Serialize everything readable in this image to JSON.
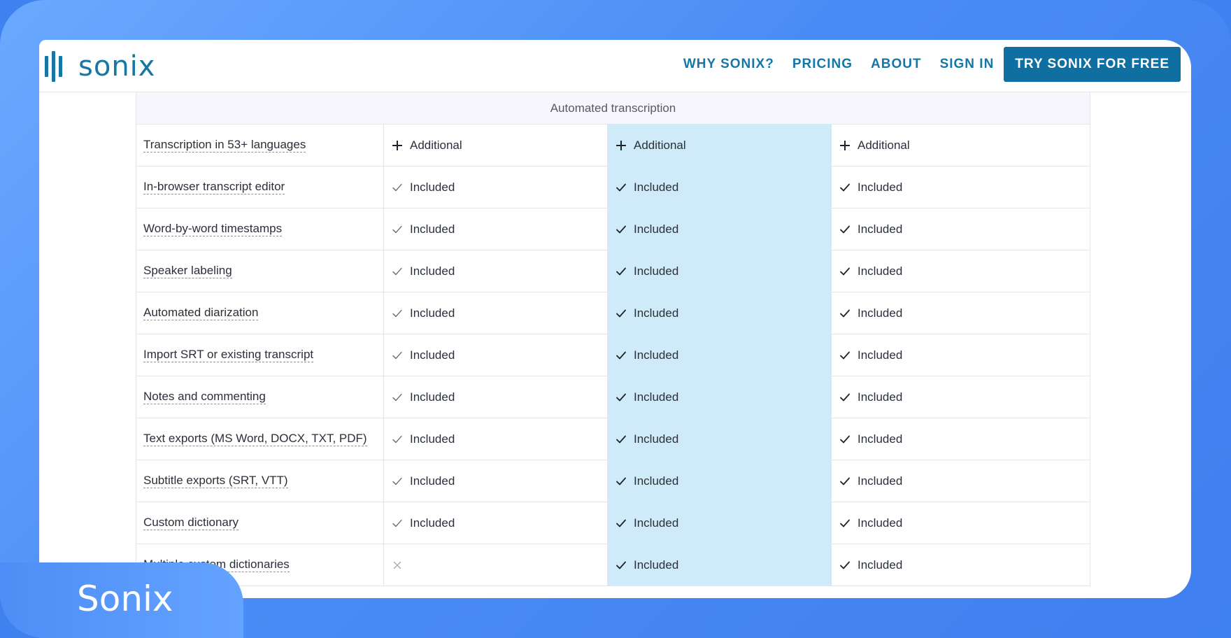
{
  "brand": {
    "name": "sonix",
    "badge_label": "Sonix",
    "primary_color": "#1677a6",
    "highlight_column_color": "#cfeaf8"
  },
  "nav": {
    "items": [
      "WHY SONIX?",
      "PRICING",
      "ABOUT",
      "SIGN IN"
    ],
    "cta_label": "TRY SONIX FOR FREE"
  },
  "table": {
    "section_title": "Automated transcription",
    "rows": [
      {
        "feature": "Transcription in 53+ languages",
        "values": [
          {
            "icon": "plus-icon",
            "text": "Additional"
          },
          {
            "icon": "plus-icon",
            "text": "Additional"
          },
          {
            "icon": "plus-icon",
            "text": "Additional"
          }
        ]
      },
      {
        "feature": "In-browser transcript editor",
        "values": [
          {
            "icon": "check-light-icon",
            "text": "Included"
          },
          {
            "icon": "check-icon",
            "text": "Included"
          },
          {
            "icon": "check-icon",
            "text": "Included"
          }
        ]
      },
      {
        "feature": "Word-by-word timestamps",
        "values": [
          {
            "icon": "check-light-icon",
            "text": "Included"
          },
          {
            "icon": "check-icon",
            "text": "Included"
          },
          {
            "icon": "check-icon",
            "text": "Included"
          }
        ]
      },
      {
        "feature": "Speaker labeling",
        "values": [
          {
            "icon": "check-light-icon",
            "text": "Included"
          },
          {
            "icon": "check-icon",
            "text": "Included"
          },
          {
            "icon": "check-icon",
            "text": "Included"
          }
        ]
      },
      {
        "feature": "Automated diarization",
        "values": [
          {
            "icon": "check-light-icon",
            "text": "Included"
          },
          {
            "icon": "check-icon",
            "text": "Included"
          },
          {
            "icon": "check-icon",
            "text": "Included"
          }
        ]
      },
      {
        "feature": "Import SRT or existing transcript",
        "values": [
          {
            "icon": "check-light-icon",
            "text": "Included"
          },
          {
            "icon": "check-icon",
            "text": "Included"
          },
          {
            "icon": "check-icon",
            "text": "Included"
          }
        ]
      },
      {
        "feature": "Notes and commenting",
        "values": [
          {
            "icon": "check-light-icon",
            "text": "Included"
          },
          {
            "icon": "check-icon",
            "text": "Included"
          },
          {
            "icon": "check-icon",
            "text": "Included"
          }
        ]
      },
      {
        "feature": "Text exports (MS Word, DOCX, TXT, PDF)",
        "values": [
          {
            "icon": "check-light-icon",
            "text": "Included"
          },
          {
            "icon": "check-icon",
            "text": "Included"
          },
          {
            "icon": "check-icon",
            "text": "Included"
          }
        ]
      },
      {
        "feature": "Subtitle exports (SRT, VTT)",
        "values": [
          {
            "icon": "check-light-icon",
            "text": "Included"
          },
          {
            "icon": "check-icon",
            "text": "Included"
          },
          {
            "icon": "check-icon",
            "text": "Included"
          }
        ]
      },
      {
        "feature": "Custom dictionary",
        "values": [
          {
            "icon": "check-light-icon",
            "text": "Included"
          },
          {
            "icon": "check-icon",
            "text": "Included"
          },
          {
            "icon": "check-icon",
            "text": "Included"
          }
        ]
      },
      {
        "feature": "Multiple custom dictionaries",
        "values": [
          {
            "icon": "x-icon",
            "text": ""
          },
          {
            "icon": "check-icon",
            "text": "Included"
          },
          {
            "icon": "check-icon",
            "text": "Included"
          }
        ]
      }
    ]
  }
}
